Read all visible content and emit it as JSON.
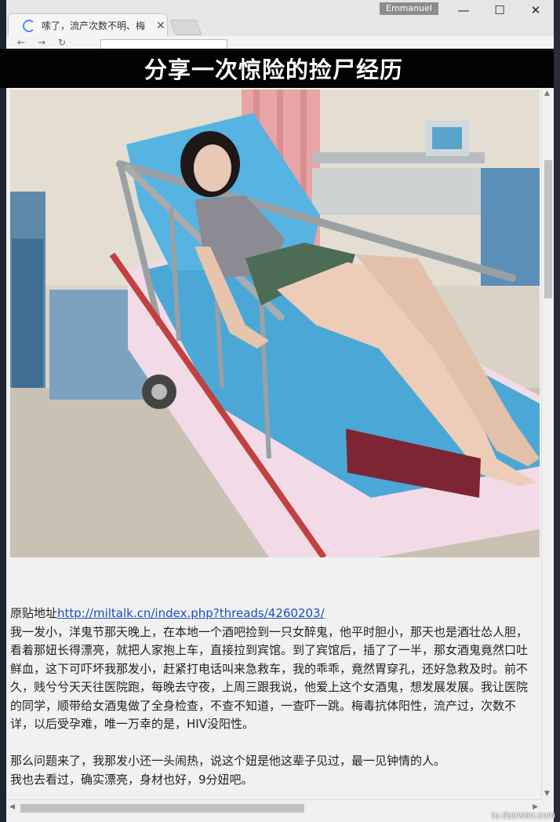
{
  "browser": {
    "tab_title": "嗦了，流产次数不明、梅",
    "profile_name": "Emmanuel",
    "minimize_glyph": "—",
    "maximize_glyph": "☐",
    "close_glyph": "✕",
    "tab_close_glyph": "✕"
  },
  "banner": {
    "title": "分享一次惊险的捡尸经历"
  },
  "post": {
    "source_label": "原贴地址",
    "source_url": "http://miltalk.cn/index.php?threads/4260203/",
    "paragraph_1": "我一发小，洋鬼节那天晚上，在本地一个酒吧捡到一只女醉鬼，他平时胆小，那天也是酒壮怂人胆，看着那妞长得漂亮，就把人家抱上车，直接拉到宾馆。到了宾馆后，插了了一半，那女酒鬼竟然口吐鲜血，这下可吓坏我那发小，赶紧打电话叫来急救车，我的乖乖，竟然胃穿孔，还好急救及时。前不久，贱兮兮天天往医院跑，每晚去守夜，上周三跟我说，他爱上这个女酒鬼，想发展发展。我让医院的同学，顺带给女酒鬼做了全身检查，不查不知道，一查吓一跳。梅毒抗体阳性，流产过，次数不详，以后受孕难，唯一万幸的是，HIV没阳性。",
    "paragraph_2": "那么问题来了，我那发小还一头闹热，说这个妞是他这辈子见过，最一见钟情的人。",
    "paragraph_3": "我也去看过，确实漂亮，身材也好，9分妞吧。"
  },
  "watermark": "tu.duowan.com"
}
